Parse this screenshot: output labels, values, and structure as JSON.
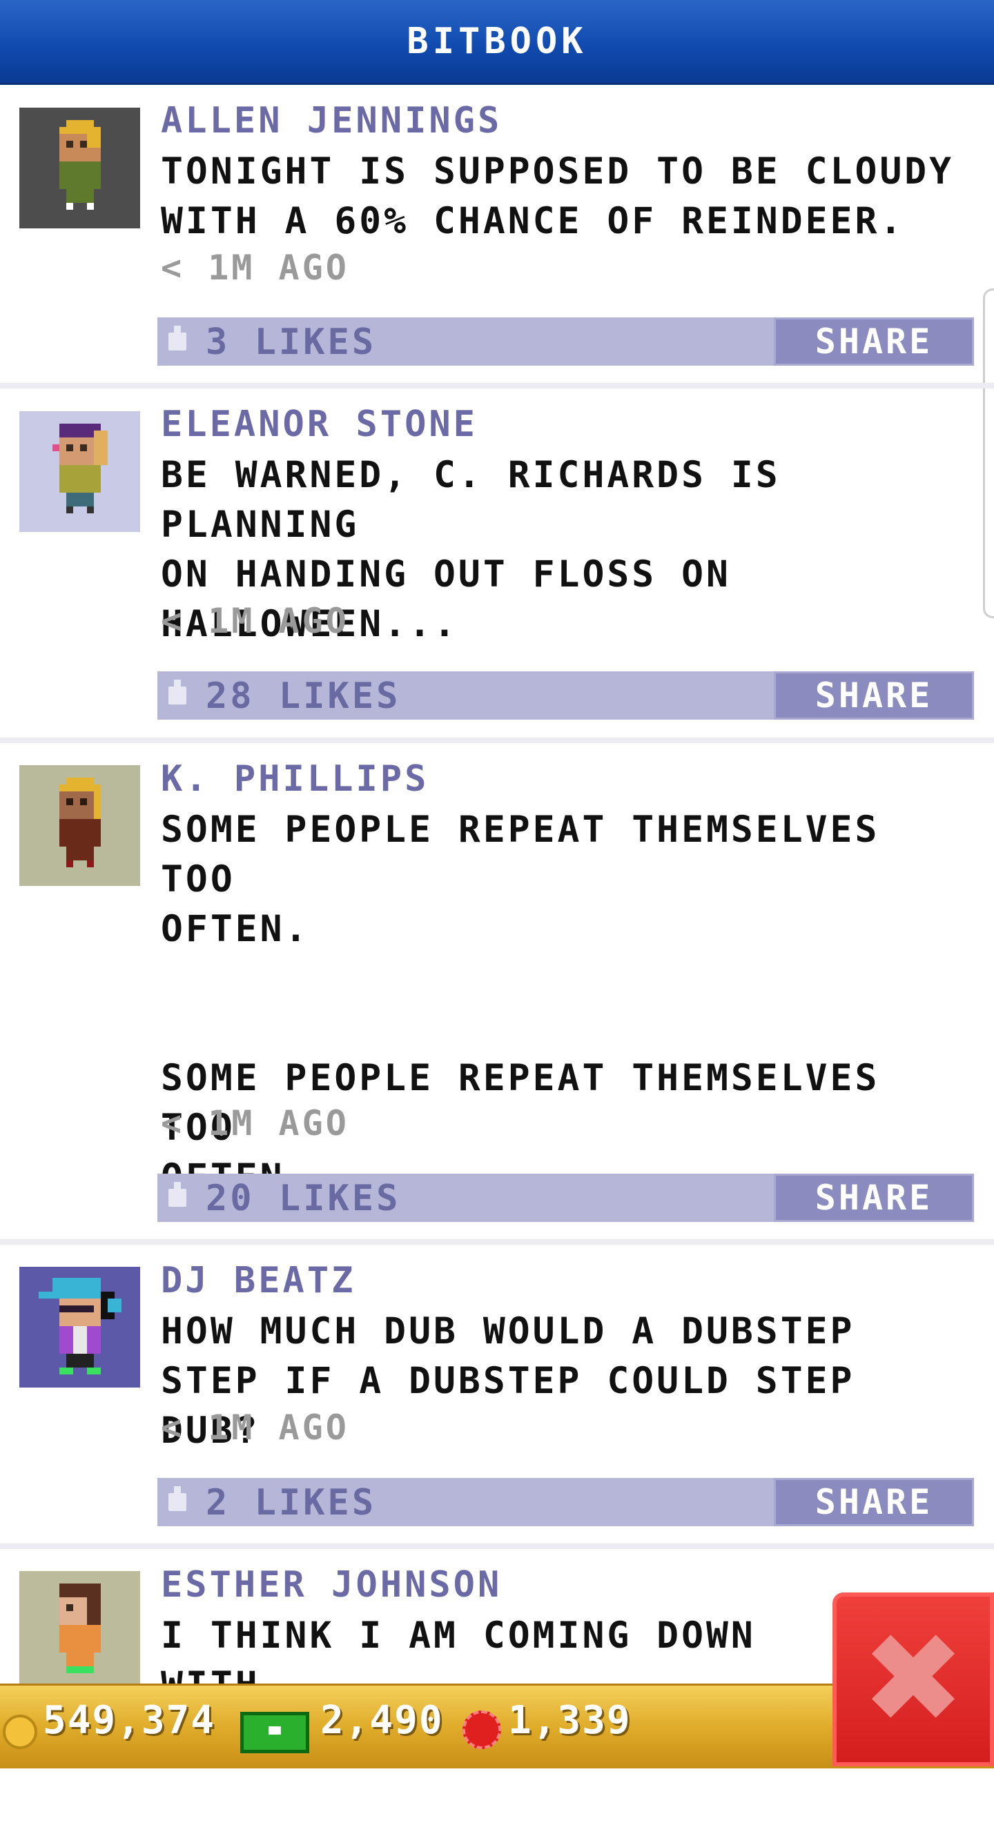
{
  "app": {
    "title": "BITBOOK"
  },
  "posts": [
    {
      "author": "ALLEN JENNINGS",
      "message": "TONIGHT IS SUPPOSED TO BE CLOUDY\nWITH A 60% CHANCE OF REINDEER.",
      "time": "< 1M AGO",
      "likes": "3 LIKES",
      "share": "SHARE",
      "avatar_bg": "#4d4d4d"
    },
    {
      "author": "ELEANOR STONE",
      "message": "BE WARNED, C. RICHARDS IS PLANNING\nON HANDING OUT FLOSS ON\nHALLOWEEN...",
      "time": "< 1M AGO",
      "likes": "28 LIKES",
      "share": "SHARE",
      "avatar_bg": "#c9cae6"
    },
    {
      "author": "K. PHILLIPS",
      "message": "SOME PEOPLE REPEAT THEMSELVES TOO\nOFTEN.\n\n\nSOME PEOPLE REPEAT THEMSELVES TOO\nOFTEN.",
      "time": "< 1M AGO",
      "likes": "20 LIKES",
      "share": "SHARE",
      "avatar_bg": "#b9b99b"
    },
    {
      "author": "DJ BEATZ",
      "message": "HOW MUCH DUB WOULD A DUBSTEP\nSTEP IF A DUBSTEP COULD STEP DUB?",
      "time": "< 1M AGO",
      "likes": "2 LIKES",
      "share": "SHARE",
      "avatar_bg": "#5c5aa8"
    },
    {
      "author": "ESTHER JOHNSON",
      "message": "I THINK I AM COMING DOWN WITH",
      "avatar_bg": "#bcbb9c"
    }
  ],
  "footer": {
    "coins": "549,374",
    "bux": "2,490",
    "gems": "1,339"
  },
  "colors": {
    "header": "#114bb0",
    "author": "#6b6aa6",
    "likebar": "#b5b6d8",
    "share": "#8b8bc0",
    "footer": "#e0ac2a",
    "close": "#d41e1e"
  }
}
